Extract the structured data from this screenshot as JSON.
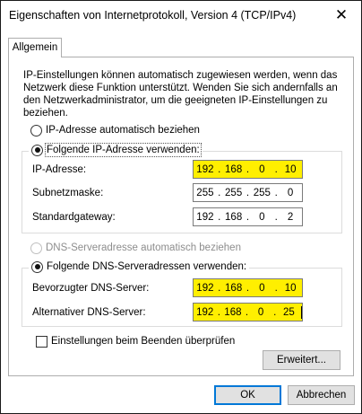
{
  "window": {
    "title": "Eigenschaften von Internetprotokoll, Version 4 (TCP/IPv4)"
  },
  "tabs": [
    {
      "label": "Allgemein",
      "selected": true
    }
  ],
  "description": "IP-Einstellungen können automatisch zugewiesen werden, wenn das Netzwerk diese Funktion unterstützt. Wenden Sie sich andernfalls an den Netzwerkadministrator, um die geeigneten IP-Einstellungen zu beziehen.",
  "ip_section": {
    "auto_label": "IP-Adresse automatisch beziehen",
    "manual_label": "Folgende IP-Adresse verwenden:",
    "selected": "manual",
    "fields": [
      {
        "label": "IP-Adresse:",
        "octets": [
          "192",
          "168",
          "0",
          "10"
        ],
        "highlighted": true
      },
      {
        "label": "Subnetzmaske:",
        "octets": [
          "255",
          "255",
          "255",
          "0"
        ],
        "highlighted": false
      },
      {
        "label": "Standardgateway:",
        "octets": [
          "192",
          "168",
          "0",
          "2"
        ],
        "highlighted": false
      }
    ]
  },
  "dns_section": {
    "auto_label": "DNS-Serveradresse automatisch beziehen",
    "auto_disabled": true,
    "manual_label": "Folgende DNS-Serveradressen verwenden:",
    "selected": "manual",
    "fields": [
      {
        "label": "Bevorzugter DNS-Server:",
        "octets": [
          "192",
          "168",
          "0",
          "10"
        ],
        "highlighted": true
      },
      {
        "label": "Alternativer DNS-Server:",
        "octets": [
          "192",
          "168",
          "0",
          "25"
        ],
        "highlighted": true,
        "has_caret": true
      }
    ]
  },
  "validate_checkbox": {
    "label": "Einstellungen beim Beenden überprüfen",
    "checked": false
  },
  "buttons": {
    "advanced": "Erweitert...",
    "ok": "OK",
    "cancel": "Abbrechen"
  },
  "icons": {
    "close": "close-icon"
  },
  "colors": {
    "highlight": "#ffef00",
    "default_button_border": "#0078d7"
  }
}
